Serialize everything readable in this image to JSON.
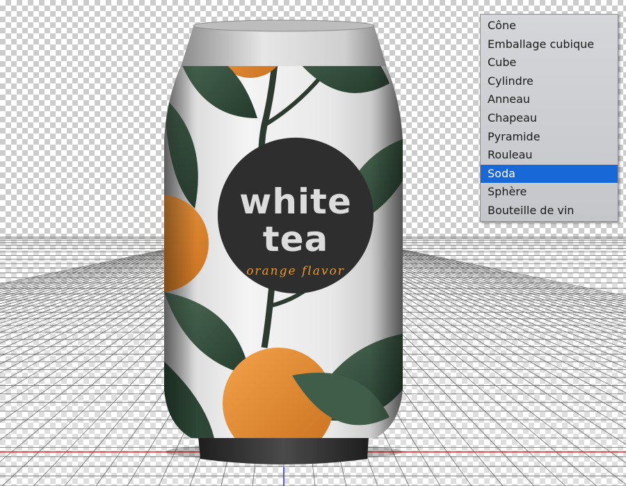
{
  "menu": {
    "items": [
      {
        "label": "Cône",
        "selected": false
      },
      {
        "label": "Emballage cubique",
        "selected": false
      },
      {
        "label": "Cube",
        "selected": false
      },
      {
        "label": "Cylindre",
        "selected": false
      },
      {
        "label": "Anneau",
        "selected": false
      },
      {
        "label": "Chapeau",
        "selected": false
      },
      {
        "label": "Pyramide",
        "selected": false
      },
      {
        "label": "Rouleau",
        "selected": false
      },
      {
        "label": "Soda",
        "selected": true
      },
      {
        "label": "Sphère",
        "selected": false
      },
      {
        "label": "Bouteille de vin",
        "selected": false
      }
    ],
    "selected_color": "#1868d8"
  },
  "can": {
    "brand_line1": "white",
    "brand_line2": "tea",
    "flavor": "orange flavor",
    "colors": {
      "leaf": "#3d5a45",
      "orange": "#e8923a",
      "label_circle": "#2e2e2e",
      "flavor_text": "#e69a2e"
    }
  },
  "grid": {
    "axis_x_color": "#e02020",
    "axis_y_color": "#2030e0"
  }
}
